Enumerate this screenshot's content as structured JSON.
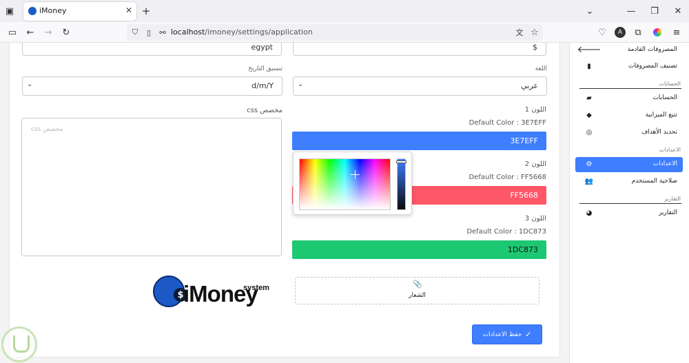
{
  "browser": {
    "tab_title": "iMoney",
    "url_host": "localhost",
    "url_path": "/imoney/settings/application"
  },
  "form": {
    "country_value": "egypt",
    "currency_value": "$",
    "date_format_label": "تنسيق التاريخ",
    "date_format_value": "d/m/Y",
    "language_label": "اللغة",
    "language_value": "عربي",
    "custom_css_label": "css مخصص",
    "custom_css_placeholder": "css مخصص",
    "colors": [
      {
        "label": "اللون 1",
        "default_text": "Default Color : 3E7EFF",
        "value": "3E7EFF",
        "hex": "#3E7EFF"
      },
      {
        "label": "اللون 2",
        "default_text": "Default Color : FF5668",
        "value": "FF5668",
        "hex": "#FF5668"
      },
      {
        "label": "اللون 3",
        "default_text": "Default Color : 1DC873",
        "value": "1DC873",
        "hex": "#1DC873"
      }
    ],
    "logo_upload_label": "الشعار",
    "save_label": "حفظ الاعدادات"
  },
  "logo": {
    "name": "iMoney",
    "tagline": "system",
    "coin_symbol": "$"
  },
  "sidebar": {
    "items_top": [
      {
        "label": "المصروفات القادمة",
        "icon": "arrow-left-icon"
      },
      {
        "label": "تصنيف المصروفات",
        "icon": "bookmark-icon"
      }
    ],
    "section_accounts": "الحسابات",
    "items_accounts": [
      {
        "label": "الحسابات",
        "icon": "folder-open-icon"
      },
      {
        "label": "تتبع الميزانية",
        "icon": "tags-icon"
      },
      {
        "label": "تحديد الأهداف",
        "icon": "life-ring-icon"
      }
    ],
    "section_settings": "الاعدادات",
    "items_settings": [
      {
        "label": "الاعدادات",
        "icon": "gear-icon",
        "active": true
      },
      {
        "label": "صلاحية المستخدم",
        "icon": "users-icon"
      }
    ],
    "section_reports": "التقارير",
    "items_reports": [
      {
        "label": "التقارير",
        "icon": "pie-chart-icon"
      }
    ]
  }
}
